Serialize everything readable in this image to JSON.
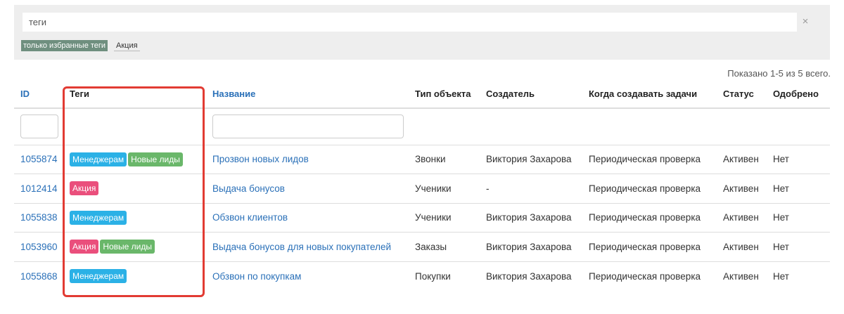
{
  "search": {
    "value": "теги",
    "clear_icon": "×"
  },
  "tag_filters": [
    {
      "label": "только избранные теги",
      "active": true
    },
    {
      "label": "Акция",
      "active": false
    }
  ],
  "summary": "Показано 1-5 из 5 всего.",
  "columns": [
    {
      "label": "ID",
      "sortable": true
    },
    {
      "label": "Теги",
      "sortable": false
    },
    {
      "label": "Название",
      "sortable": true
    },
    {
      "label": "Тип объекта",
      "sortable": false
    },
    {
      "label": "Создатель",
      "sortable": false
    },
    {
      "label": "Когда создавать задачи",
      "sortable": false
    },
    {
      "label": "Статус",
      "sortable": false
    },
    {
      "label": "Одобрено",
      "sortable": false
    }
  ],
  "tag_colors": {
    "Менеджерам": "#2bb1e6",
    "Новые лиды": "#6ab76a",
    "Акция": "#ea4f7c"
  },
  "colors": {
    "link": "#2a70b8",
    "highlight": "#e23b33"
  },
  "rows": [
    {
      "id": "1055874",
      "tags": [
        "Менеджерам",
        "Новые лиды"
      ],
      "name": "Прозвон новых лидов",
      "object_type": "Звонки",
      "creator": "Виктория Захарова",
      "when": "Периодическая проверка",
      "status": "Активен",
      "approved": "Нет"
    },
    {
      "id": "1012414",
      "tags": [
        "Акция"
      ],
      "name": "Выдача бонусов",
      "object_type": "Ученики",
      "creator": "-",
      "when": "Периодическая проверка",
      "status": "Активен",
      "approved": "Нет"
    },
    {
      "id": "1055838",
      "tags": [
        "Менеджерам"
      ],
      "name": "Обзвон клиентов",
      "object_type": "Ученики",
      "creator": "Виктория Захарова",
      "when": "Периодическая проверка",
      "status": "Активен",
      "approved": "Нет"
    },
    {
      "id": "1053960",
      "tags": [
        "Акция",
        "Новые лиды"
      ],
      "name": "Выдача бонусов для новых покупателей",
      "object_type": "Заказы",
      "creator": "Виктория Захарова",
      "when": "Периодическая проверка",
      "status": "Активен",
      "approved": "Нет"
    },
    {
      "id": "1055868",
      "tags": [
        "Менеджерам"
      ],
      "name": "Обзвон по покупкам",
      "object_type": "Покупки",
      "creator": "Виктория Захарова",
      "when": "Периодическая проверка",
      "status": "Активен",
      "approved": "Нет"
    }
  ]
}
